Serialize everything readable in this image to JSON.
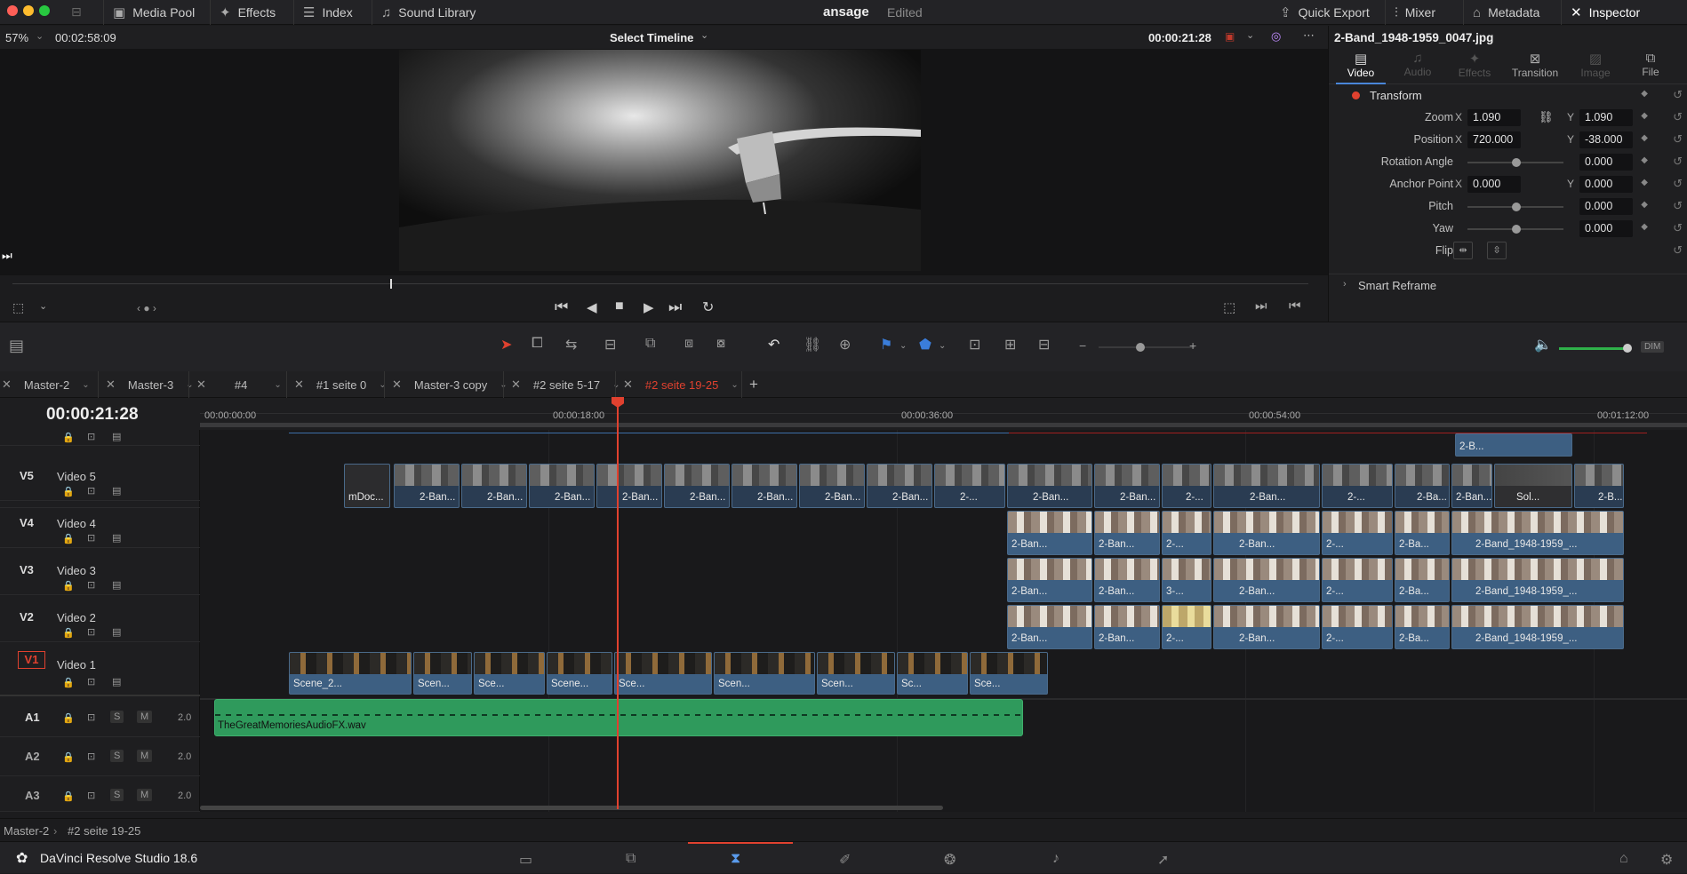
{
  "topbar": {
    "media_pool": "Media Pool",
    "effects": "Effects",
    "index": "Index",
    "sound_library": "Sound Library",
    "project_title": "ansage",
    "project_status": "Edited",
    "quick_export": "Quick Export",
    "mixer": "Mixer",
    "metadata": "Metadata",
    "inspector": "Inspector"
  },
  "viewer": {
    "zoom": "57%",
    "duration": "00:02:58:09",
    "timeline_select": "Select Timeline",
    "timecode": "00:00:21:28"
  },
  "inspector": {
    "clip_name": "2-Band_1948-1959_0047.jpg",
    "tabs": [
      "Video",
      "Audio",
      "Effects",
      "Transition",
      "Image",
      "File"
    ],
    "section_transform": "Transform",
    "zoom_label": "Zoom",
    "zoom_x": "1.090",
    "zoom_y": "1.090",
    "position_label": "Position",
    "position_x": "720.000",
    "position_y": "-38.000",
    "rotation_label": "Rotation Angle",
    "rotation": "0.000",
    "anchor_label": "Anchor Point",
    "anchor_x": "0.000",
    "anchor_y": "0.000",
    "pitch_label": "Pitch",
    "pitch": "0.000",
    "yaw_label": "Yaw",
    "yaw": "0.000",
    "flip_label": "Flip",
    "smart_reframe": "Smart Reframe",
    "x": "X",
    "y": "Y"
  },
  "tabs": [
    "Master-2",
    "Master-3",
    "#4",
    "#1 seite 0",
    "Master-3 copy",
    "#2 seite 5-17",
    "#2 seite 19-25"
  ],
  "timeline": {
    "timecode": "00:00:21:28",
    "ruler": [
      "00:00:00:00",
      "00:00:18:00",
      "00:00:36:00",
      "00:00:54:00",
      "00:01:12:00"
    ],
    "tracks": [
      {
        "id": "V5",
        "name": "Video 5"
      },
      {
        "id": "V4",
        "name": "Video 4"
      },
      {
        "id": "V3",
        "name": "Video 3"
      },
      {
        "id": "V2",
        "name": "Video 2"
      },
      {
        "id": "V1",
        "name": "Video 1"
      }
    ],
    "audio_tracks": [
      {
        "id": "A1",
        "level": "2.0"
      },
      {
        "id": "A2",
        "level": "2.0"
      },
      {
        "id": "A3",
        "level": "2.0"
      }
    ],
    "audio_clip": "TheGreatMemoriesAudioFX.wav",
    "v1_clips": [
      "Scene_2...",
      "Scen...",
      "Sce...",
      "Scene...",
      "Sce...",
      "Scen...",
      "Scen...",
      "Sc...",
      "Sce..."
    ],
    "v5_clips": [
      "mDoc...",
      "2-Ban...",
      "2-Ban...",
      "2-Ban...",
      "2-Ban...",
      "2-Ban...",
      "2-Ban...",
      "2-Ban...",
      "2-Ban...",
      "2-...",
      "2-Ban...",
      "2-Ban...",
      "2-...",
      "2-Ban...",
      "2-...",
      "2-Ba...",
      "2-Ban...",
      "Sol...",
      "2-B..."
    ],
    "top_clip": "2-B...",
    "v4_clips": [
      "2-Ban...",
      "2-Ban...",
      "2-...",
      "2-Ban...",
      "2-...",
      "2-Ba...",
      "2-Band_1948-1959_..."
    ],
    "v3_clips": [
      "2-Ban...",
      "2-Ban...",
      "3-...",
      "2-Ban...",
      "2-...",
      "2-Ba...",
      "2-Band_1948-1959_..."
    ],
    "v2_clips": [
      "2-Ban...",
      "2-Ban...",
      "2-...",
      "2-Ban...",
      "2-...",
      "2-Ba...",
      "2-Band_1948-1959_..."
    ],
    "s_label": "S",
    "m_label": "M"
  },
  "toolbar": {
    "dim": "DIM"
  },
  "status": {
    "breadcrumb_root": "Master-2",
    "breadcrumb_current": "#2 seite 19-25"
  },
  "app": {
    "name": "DaVinci Resolve Studio 18.6"
  }
}
